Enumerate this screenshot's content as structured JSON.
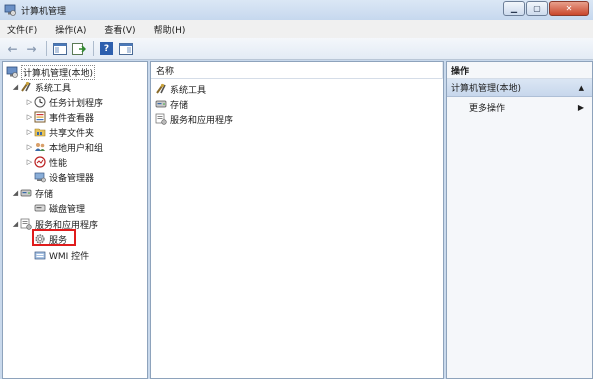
{
  "window": {
    "title": "计算机管理",
    "min_glyph": "▁",
    "max_glyph": "▢",
    "close_glyph": "✕"
  },
  "menu": [
    "文件(F)",
    "操作(A)",
    "查看(V)",
    "帮助(H)"
  ],
  "toolbar": {
    "back_icon": "←",
    "forward_icon": "→",
    "help_glyph": "?"
  },
  "tree": {
    "root": "计算机管理(本地)",
    "system_tools": "系统工具",
    "task_scheduler": "任务计划程序",
    "event_viewer": "事件查看器",
    "shared_folders": "共享文件夹",
    "local_users": "本地用户和组",
    "performance": "性能",
    "device_manager": "设备管理器",
    "storage": "存储",
    "disk_management": "磁盘管理",
    "services_apps": "服务和应用程序",
    "services": "服务",
    "wmi": "WMI 控件",
    "expanded_arrow": "◢",
    "collapsed_arrow": "▷"
  },
  "middle": {
    "column_header": "名称",
    "items": [
      "系统工具",
      "存储",
      "服务和应用程序"
    ]
  },
  "actions": {
    "header": "操作",
    "section_title": "计算机管理(本地)",
    "section_caret": "▲",
    "more": "更多操作",
    "more_caret": "▶"
  },
  "colors": {
    "highlight": "#e01c1c",
    "selection": "#c7d7ec"
  }
}
